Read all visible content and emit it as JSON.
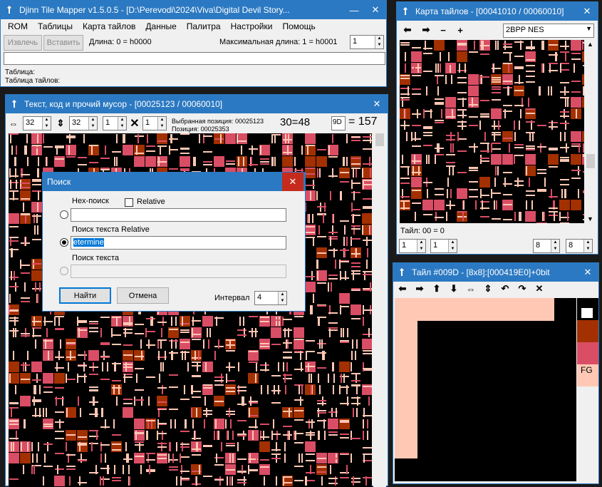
{
  "main": {
    "title": "Djinn Tile Mapper v1.5.0.5 - [D:\\Perevodi\\2024\\Viva\\Digital Devil Story...",
    "menu": [
      "ROM",
      "Таблицы",
      "Карта тайлов",
      "Данные",
      "Палитра",
      "Настройки",
      "Помощь"
    ],
    "extract_label": "Извлечь",
    "insert_label": "Вставить",
    "length_text": "Длина: 0 = h0000",
    "max_length_text": "Максимальная длина: 1 = h0001",
    "spin_value": "1",
    "table_label": "Таблица:",
    "tile_table_label": "Таблица тайлов:"
  },
  "text_window": {
    "title": "Текст, код и прочий мусор - [00025123 / 00060010]",
    "spin1": "32",
    "spin2": "32",
    "spin3": "1",
    "spin4": "1",
    "selected_pos": "Выбранная позиция: 00025123",
    "position": "Позиция: 00025353",
    "eq_text": "30=48",
    "hex_value": "9D",
    "dec_value": "= 157"
  },
  "search_dialog": {
    "title": "Поиск",
    "hex_search_label": "Hex-поиск",
    "relative_label": "Relative",
    "hex_value": "",
    "text_relative_label": "Поиск текста Relative",
    "text_relative_value": "etermine",
    "text_search_label": "Поиск текста",
    "text_value": "",
    "find_label": "Найти",
    "cancel_label": "Отмена",
    "interval_label": "Интервал",
    "interval_value": "4"
  },
  "tilemap_window": {
    "title": "Карта тайлов - [00041010 / 00060010]",
    "codec": "2BPP NES",
    "tile_label": "Тайл: 00 = 0",
    "spins": [
      "1",
      "1",
      "8",
      "8"
    ]
  },
  "tile_window": {
    "title": "Тайл #009D - [8x8]:[000419E0]+0bit",
    "fg_label": "FG"
  },
  "colors": {
    "titlebar": "#2b79c2",
    "palette": [
      "#000000",
      "#ffffff",
      "#a33000",
      "#d94d65",
      "#ffc8b4"
    ]
  }
}
